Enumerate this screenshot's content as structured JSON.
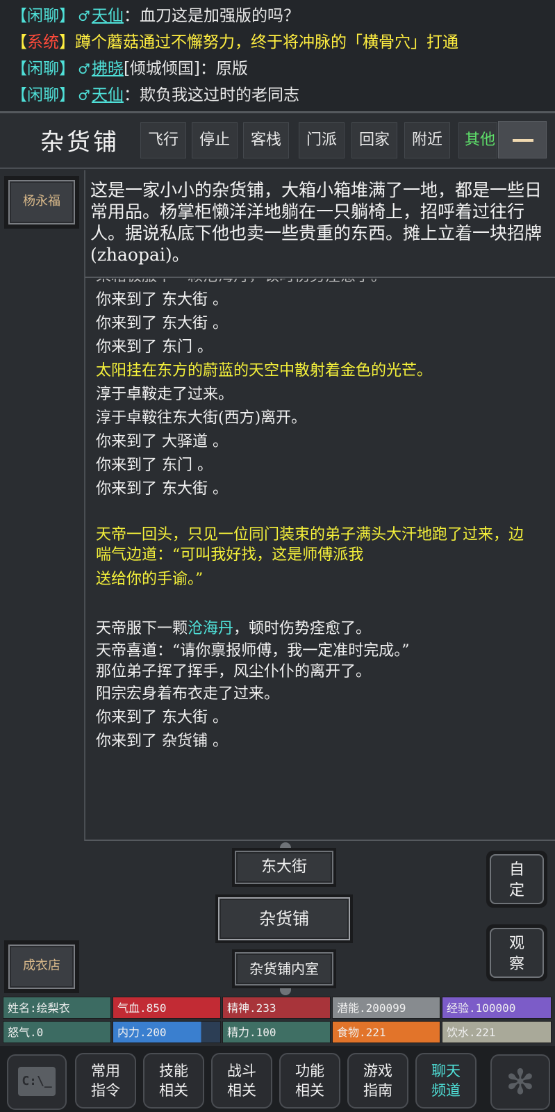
{
  "chat": [
    {
      "channel": "闲聊",
      "gender": "♂",
      "user": "天仙",
      "message": "血刀这是加强版的吗？"
    },
    {
      "channel": "系统",
      "message": "蹲个蘑菇通过不懈努力，终于将冲脉的「横骨穴」打通"
    },
    {
      "channel": "闲聊",
      "gender": "♂",
      "user": "拂晓",
      "title": "[倾城倾国]",
      "message": "原版"
    },
    {
      "channel": "闲聊",
      "gender": "♂",
      "user": "天仙",
      "message": "欺负我这过时的老同志"
    }
  ],
  "room": {
    "title": "杂货铺",
    "nav": [
      "飞行",
      "停止",
      "客栈",
      "门派",
      "回家",
      "附近",
      "其他"
    ],
    "collapse_icon": "minus-icon"
  },
  "npcs": {
    "top": "杨永福",
    "bottom": "成衣店"
  },
  "description": "这是一家小小的杂货铺，大箱小箱堆满了一地，都是一些日常用品。杨掌柜懒洋洋地躺在一只躺椅上，招呼着过往行人。据说私底下他也卖一些贵重的东西。摊上立着一块招牌(zhaopai)。",
  "log": {
    "partial": "果箱极服下一颗沧海丹，顿时伤势痊愈了。",
    "l1": "你来到了 东大街 。",
    "l2": "你来到了 东大街 。",
    "l3": "你来到了 东门 。",
    "l4": "太阳挂在东方的蔚蓝的天空中散射着金色的光芒。",
    "l5": "淳于卓鞍走了过来。",
    "l6": "淳于卓鞍往东大街(西方)离开。",
    "l7": "你来到了 大驿道 。",
    "l8": "你来到了 东门 。",
    "l9": "你来到了 东大街 。",
    "l10": "天帝一回头，只见一位同门装束的弟子满头大汗地跑了过来，边喘气边道：“可叫我好找，这是师傅派我",
    "l11": "送给你的手谕。”",
    "l12a": "天帝服下一颗",
    "l12b": "沧海丹",
    "l12c": "，顿时伤势痊愈了。",
    "l13": "天帝喜道：“请你禀报师傅，我一定准时完成。”",
    "l14": "那位弟子挥了挥手，风尘仆仆的离开了。",
    "l15": "阳宗宏身着布衣走了过来。",
    "l16": "你来到了 东大街 。",
    "l17": "你来到了 杂货铺 。"
  },
  "exits": {
    "north": "东大街",
    "current": "杂货铺",
    "south": "杂货铺内室"
  },
  "side": {
    "custom": "自定",
    "observe": "观察"
  },
  "stats": [
    {
      "label": "姓名:绘梨衣",
      "color": "#3c6b62"
    },
    {
      "label": "气血.850",
      "color": "#c22b34"
    },
    {
      "label": "精神.233",
      "color": "#a8343a"
    },
    {
      "label": "潜能.200099",
      "color": "#878b8f"
    },
    {
      "label": "经验.100000",
      "color": "#7c5cc8"
    },
    {
      "label": "怒气.0",
      "color": "#3c6b62"
    },
    {
      "label": "内力.200",
      "color": "#3a7fcf"
    },
    {
      "label": "精力.100",
      "color": "#3f6f64"
    },
    {
      "label": "食物.221",
      "color": "#e2742a"
    },
    {
      "label": "饮水.221",
      "color": "#a9a999"
    }
  ],
  "menu": {
    "cmd_icon": "terminal-icon",
    "m1": [
      "常用",
      "指令"
    ],
    "m2": [
      "技能",
      "相关"
    ],
    "m3": [
      "战斗",
      "相关"
    ],
    "m4": [
      "功能",
      "相关"
    ],
    "m5": [
      "游戏",
      "指南"
    ],
    "m6": [
      "聊天",
      "频道"
    ],
    "gear_icon": "settings-icon"
  }
}
